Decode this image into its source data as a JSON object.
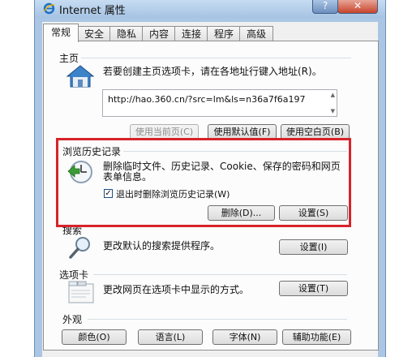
{
  "window": {
    "title": "Internet 属性",
    "help_label": "?",
    "close_label": "✕"
  },
  "tabs": [
    {
      "label": "常规",
      "active": true
    },
    {
      "label": "安全"
    },
    {
      "label": "隐私"
    },
    {
      "label": "内容"
    },
    {
      "label": "连接"
    },
    {
      "label": "程序"
    },
    {
      "label": "高级"
    }
  ],
  "homepage": {
    "section": "主页",
    "description": "若要创建主页选项卡，请在各地址行键入地址(R)。",
    "url": "http://hao.360.cn/?src=lm&ls=n36a7f6a197",
    "use_current_label": "使用当前页(C)",
    "use_default_label": "使用默认值(F)",
    "use_blank_label": "使用空白页(B)"
  },
  "history": {
    "section": "浏览历史记录",
    "description_line1": "删除临时文件、历史记录、Cookie、保存的密码和网页",
    "description_line2": "表单信息。",
    "checkbox_label": "退出时删除浏览历史记录(W)",
    "checkbox_checked": true,
    "delete_label": "删除(D)...",
    "settings_label": "设置(S)"
  },
  "search": {
    "section": "搜索",
    "description": "更改默认的搜索提供程序。",
    "settings_label": "设置(I)"
  },
  "tabs_section": {
    "section": "选项卡",
    "description": "更改网页在选项卡中显示的方式。",
    "settings_label": "设置(T)"
  },
  "appearance": {
    "section": "外观",
    "colors_label": "颜色(O)",
    "languages_label": "语言(L)",
    "fonts_label": "字体(N)",
    "accessibility_label": "辅助功能(E)"
  },
  "colors": {
    "highlight": "#d8232a",
    "titlebar": "#a6c3e3",
    "panel": "#fcfcfc"
  },
  "icons": [
    "ie-icon",
    "house-icon",
    "history-clock-icon",
    "magnifier-icon",
    "tab-window-icon"
  ]
}
